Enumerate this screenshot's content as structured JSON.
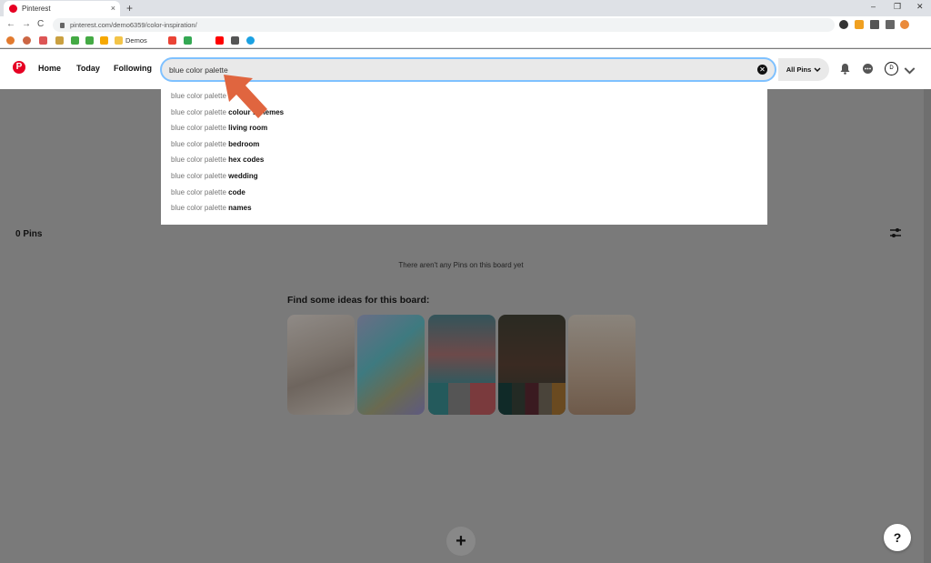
{
  "browser": {
    "tab_title": "Pinterest",
    "tab_close": "×",
    "new_tab": "+",
    "url": "pinterest.com/demo6359/color-inspiration/",
    "bookmark_label": "Demos",
    "nav": {
      "back": "←",
      "forward": "→",
      "reload": "C"
    },
    "window": {
      "minimize": "–",
      "restore": "❐",
      "close": "✕"
    }
  },
  "header": {
    "logo": "P",
    "nav": [
      "Home",
      "Today",
      "Following"
    ],
    "search_value": "blue color palette",
    "clear_icon": "✕",
    "filter_label": "All Pins",
    "avatar_initial": "D"
  },
  "suggestions": [
    {
      "prefix": "blue color palette",
      "suffix": ""
    },
    {
      "prefix": "blue color palette",
      "suffix": "colour schemes"
    },
    {
      "prefix": "blue color palette",
      "suffix": "living room"
    },
    {
      "prefix": "blue color palette",
      "suffix": "bedroom"
    },
    {
      "prefix": "blue color palette",
      "suffix": "hex codes"
    },
    {
      "prefix": "blue color palette",
      "suffix": "wedding"
    },
    {
      "prefix": "blue color palette",
      "suffix": "code"
    },
    {
      "prefix": "blue color palette",
      "suffix": "names"
    }
  ],
  "board": {
    "pins_count": "0 Pins",
    "empty_message": "There aren't any Pins on this board yet",
    "ideas_title": "Find some ideas for this board:",
    "add_button": "+",
    "help_button": "?"
  },
  "colors": {
    "brand": "#e60023",
    "search_focus": "#7fc1ff",
    "annotation_arrow": "#e0653f"
  }
}
